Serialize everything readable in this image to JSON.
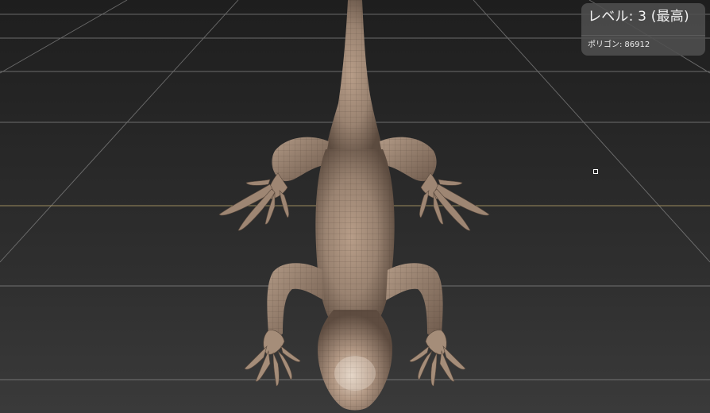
{
  "hud": {
    "level_label": "レベル: 3 (最高)",
    "polygon_label": "ポリゴン:",
    "polygon_count": "86912"
  },
  "colors": {
    "grid_line": "#a8a8a8",
    "horizon_line": "#b8a46a",
    "model_skin": "#a18a76",
    "model_wire": "#5a4a3e"
  },
  "scene": {
    "subject": "lizard-mesh",
    "cursor": "selection-cursor"
  }
}
